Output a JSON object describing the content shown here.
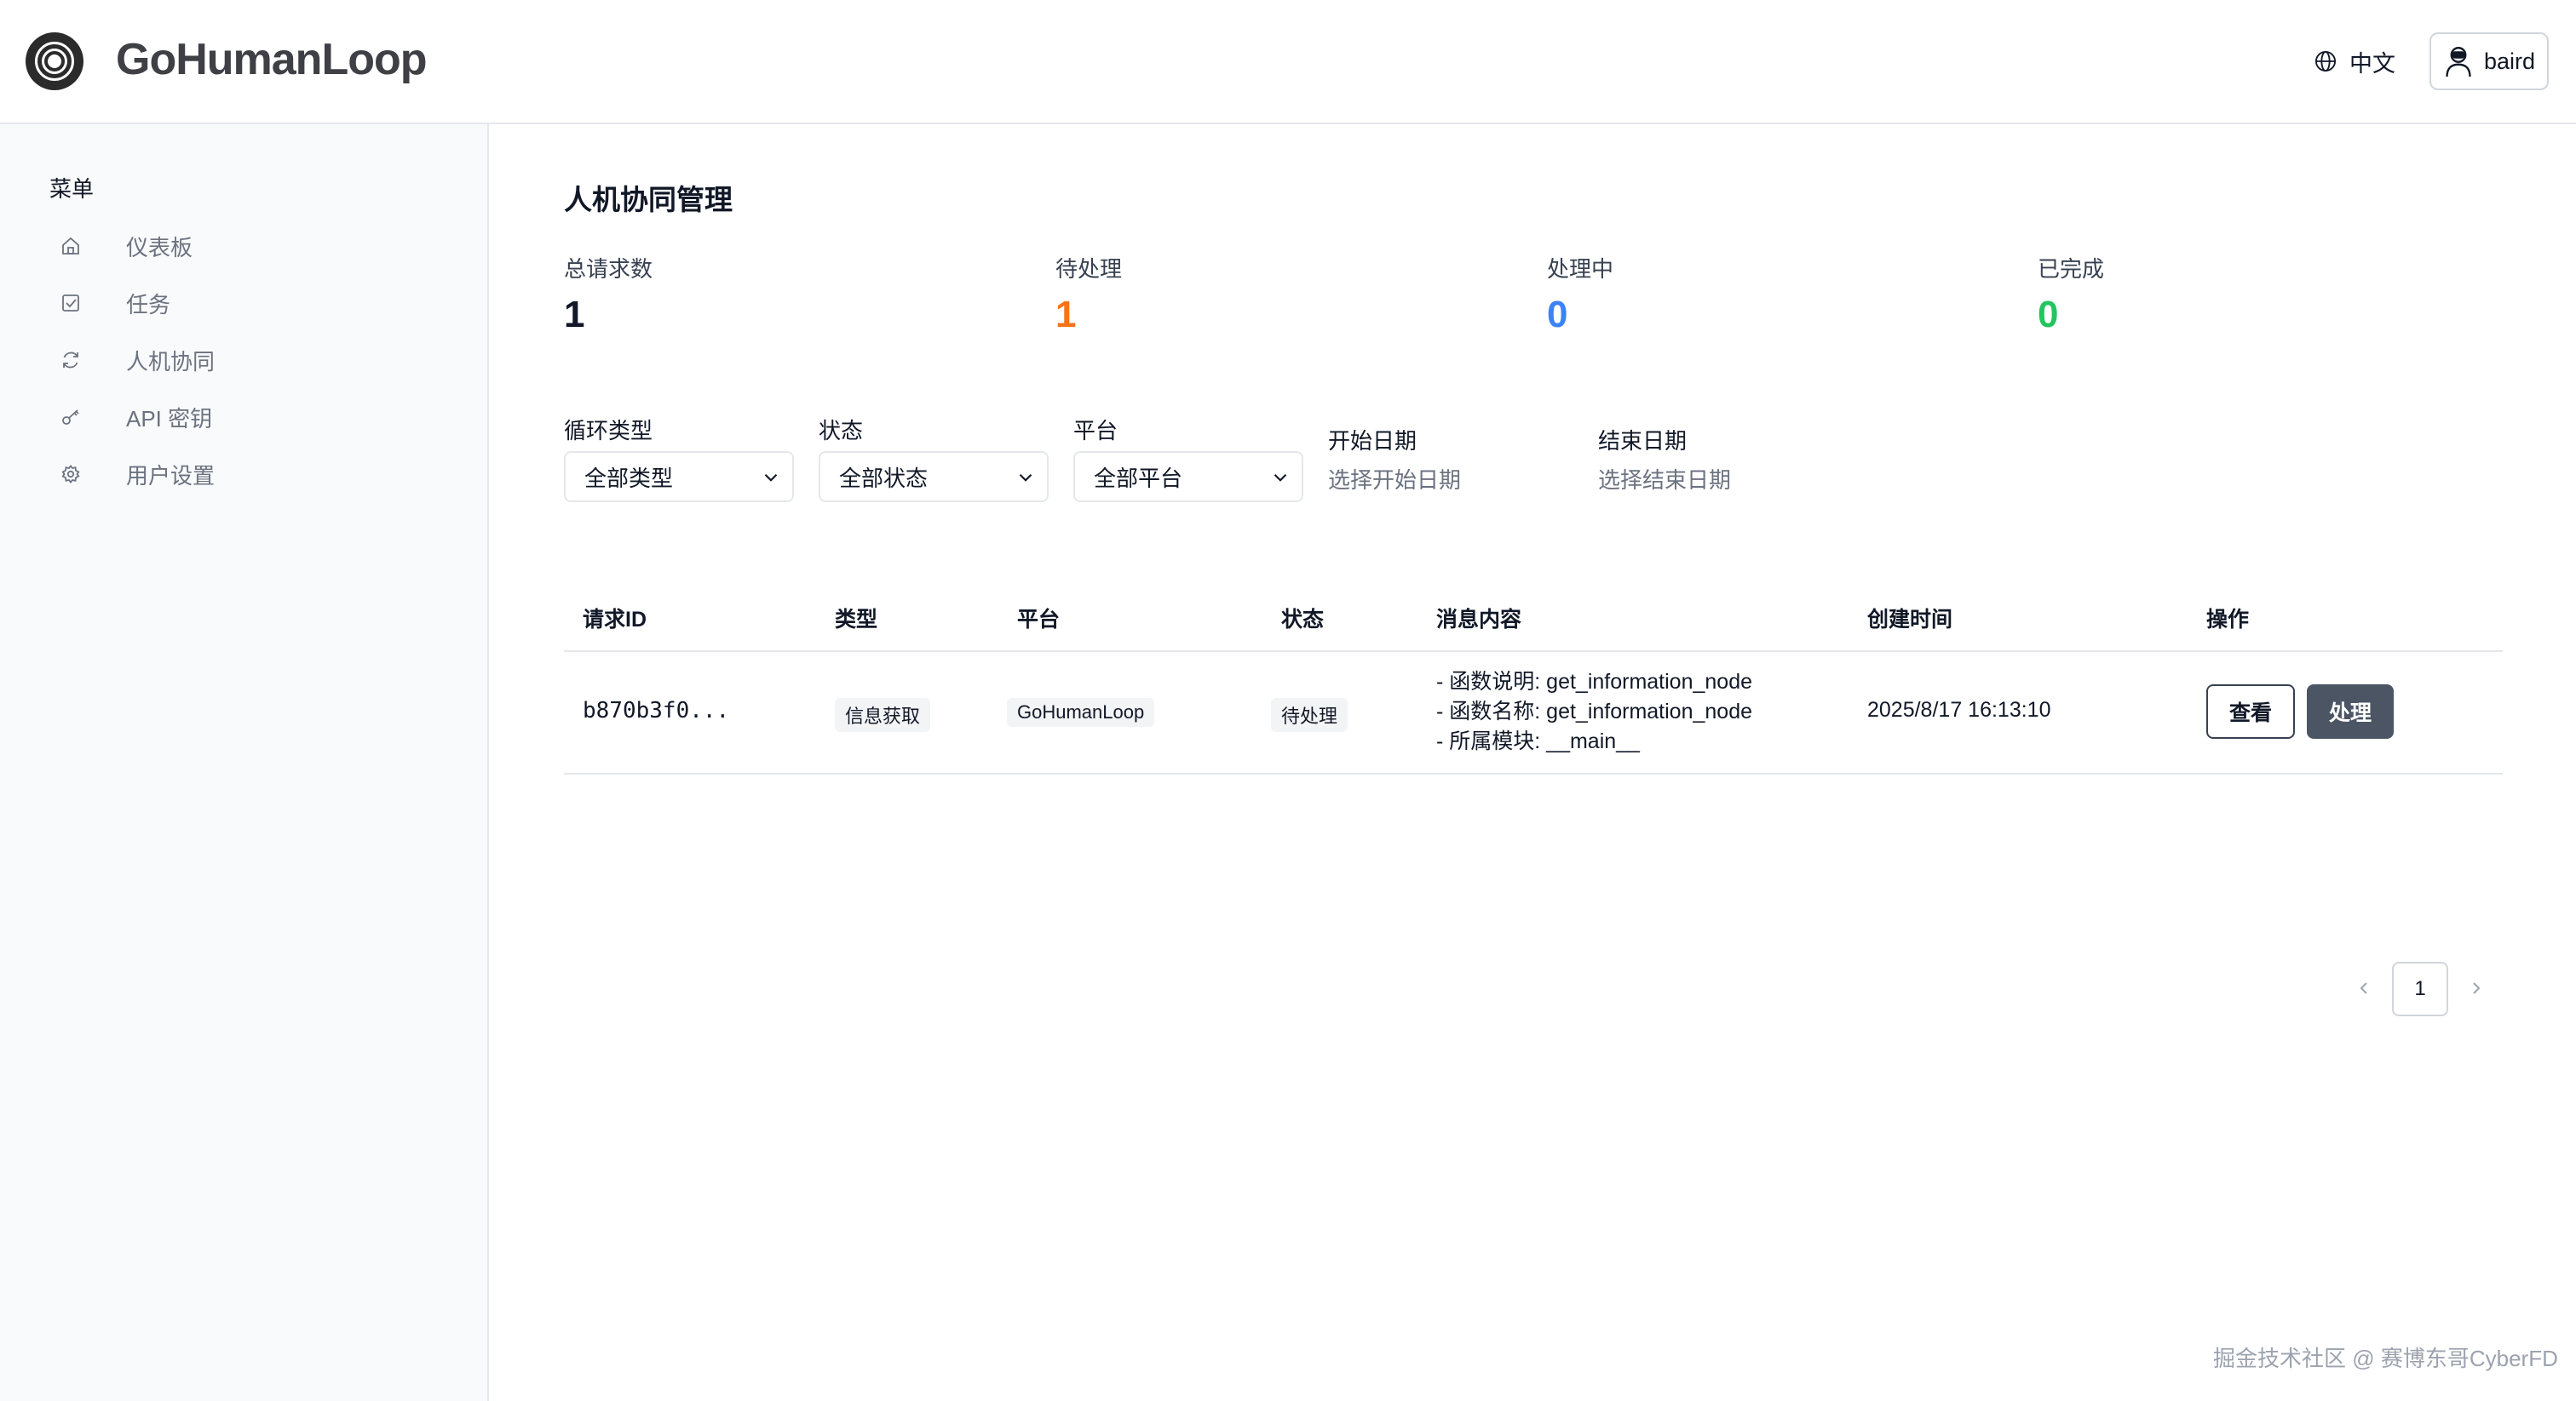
{
  "brand": {
    "name": "GoHumanLoop"
  },
  "header": {
    "language": "中文",
    "user": "baird"
  },
  "sidebar": {
    "title": "菜单",
    "items": [
      {
        "label": "仪表板",
        "icon": "home-icon"
      },
      {
        "label": "任务",
        "icon": "checkbox-icon"
      },
      {
        "label": "人机协同",
        "icon": "refresh-icon"
      },
      {
        "label": "API 密钥",
        "icon": "key-icon"
      },
      {
        "label": "用户设置",
        "icon": "gear-icon"
      }
    ]
  },
  "page": {
    "title": "人机协同管理"
  },
  "stats": [
    {
      "label": "总请求数",
      "value": "1",
      "color": "#111827"
    },
    {
      "label": "待处理",
      "value": "1",
      "color": "#f97316"
    },
    {
      "label": "处理中",
      "value": "0",
      "color": "#3b82f6"
    },
    {
      "label": "已完成",
      "value": "0",
      "color": "#22c55e"
    }
  ],
  "filters": {
    "loop_type": {
      "label": "循环类型",
      "value": "全部类型"
    },
    "status": {
      "label": "状态",
      "value": "全部状态"
    },
    "platform": {
      "label": "平台",
      "value": "全部平台"
    },
    "start_date": {
      "label": "开始日期",
      "placeholder": "选择开始日期"
    },
    "end_date": {
      "label": "结束日期",
      "placeholder": "选择结束日期"
    }
  },
  "table": {
    "headers": [
      "请求ID",
      "类型",
      "平台",
      "状态",
      "消息内容",
      "创建时间",
      "操作"
    ],
    "rows": [
      {
        "id": "b870b3f0...",
        "type": "信息获取",
        "platform": "GoHumanLoop",
        "status": "待处理",
        "message": [
          "- 函数说明: get_information_node",
          "- 函数名称: get_information_node",
          "- 所属模块: __main__"
        ],
        "created": "2025/8/17 16:13:10",
        "actions": {
          "view": "查看",
          "process": "处理"
        }
      }
    ]
  },
  "pagination": {
    "current": "1"
  },
  "watermark": "掘金技术社区 @ 赛博东哥CyberFD"
}
